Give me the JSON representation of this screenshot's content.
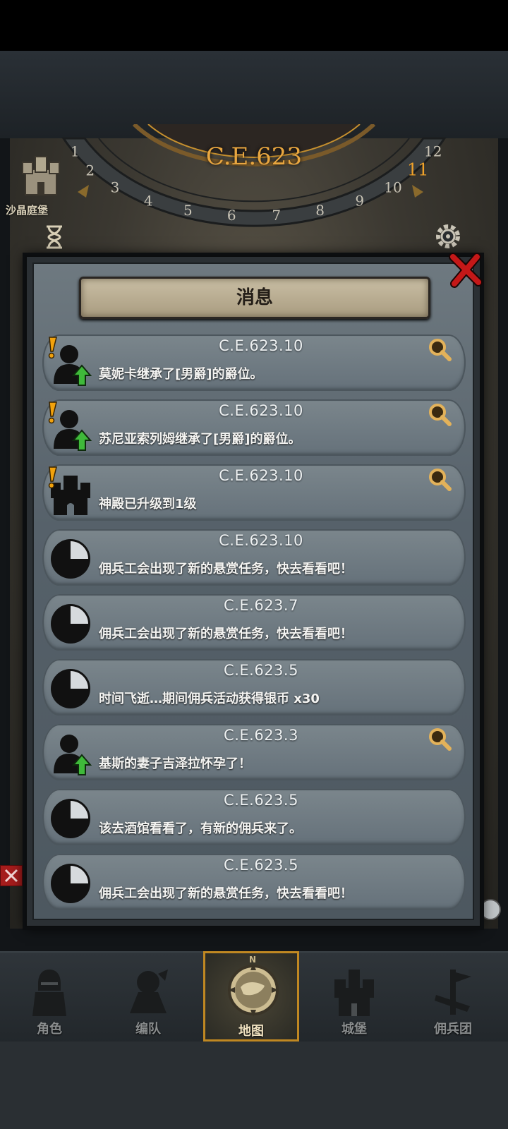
{
  "game": {
    "year": "C.E.623",
    "location_label": "沙晶庭堡",
    "dial_numbers": [
      "1",
      "2",
      "3",
      "4",
      "5",
      "6",
      "7",
      "8",
      "9",
      "10",
      "11",
      "12"
    ],
    "current_month": "11"
  },
  "dialog": {
    "title": "消息",
    "messages": [
      {
        "date": "C.E.623.10",
        "text": "莫妮卡继承了[男爵]的爵位。",
        "icon": "person-up-icon",
        "alert": true,
        "inspect": true
      },
      {
        "date": "C.E.623.10",
        "text": "苏尼亚索列姆继承了[男爵]的爵位。",
        "icon": "person-up-icon",
        "alert": true,
        "inspect": true
      },
      {
        "date": "C.E.623.10",
        "text": "神殿已升级到1级",
        "icon": "castle-icon",
        "alert": true,
        "inspect": true
      },
      {
        "date": "C.E.623.10",
        "text": "佣兵工会出现了新的悬赏任务，快去看看吧！",
        "icon": "clock-icon",
        "alert": false,
        "inspect": false
      },
      {
        "date": "C.E.623.7",
        "text": "佣兵工会出现了新的悬赏任务，快去看看吧！",
        "icon": "clock-icon",
        "alert": false,
        "inspect": false
      },
      {
        "date": "C.E.623.5",
        "text": "时间飞逝…期间佣兵活动获得银币 x30",
        "icon": "clock-icon",
        "alert": false,
        "inspect": false
      },
      {
        "date": "C.E.623.3",
        "text": "基斯的妻子吉泽拉怀孕了！",
        "icon": "person-up-icon",
        "alert": false,
        "inspect": true
      },
      {
        "date": "C.E.623.5",
        "text": "该去酒馆看看了，有新的佣兵来了。",
        "icon": "clock-icon",
        "alert": false,
        "inspect": false
      },
      {
        "date": "C.E.623.5",
        "text": "佣兵工会出现了新的悬赏任务，快去看看吧！",
        "icon": "clock-icon",
        "alert": false,
        "inspect": false
      }
    ]
  },
  "nav": {
    "compass_letter": "N",
    "tabs": [
      {
        "label": "角色",
        "icon": "knight-icon",
        "active": false
      },
      {
        "label": "编队",
        "icon": "formation-icon",
        "active": false
      },
      {
        "label": "地图",
        "icon": "map-icon",
        "active": true
      },
      {
        "label": "城堡",
        "icon": "castle-icon",
        "active": false
      },
      {
        "label": "佣兵团",
        "icon": "mercenary-icon",
        "active": false
      }
    ]
  },
  "colors": {
    "accent_gold": "#c08822",
    "year_orange": "#e8a640",
    "close_red": "#c41818",
    "upgrade_green": "#3fb93a",
    "alert_orange": "#f2a20c"
  }
}
